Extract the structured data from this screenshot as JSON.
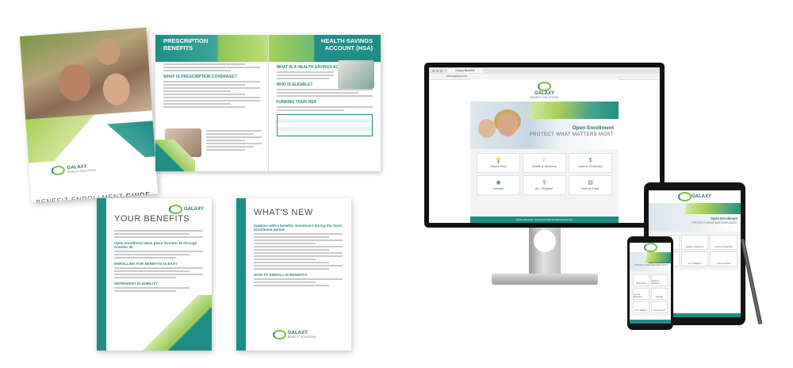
{
  "brand": {
    "name": "GALAXY",
    "tagline": "BENEFIT SOLUTIONS",
    "accent": "#1f8d86",
    "accent2": "#96c95a"
  },
  "cover": {
    "title_light": "BENEFIT ENROLLMENT",
    "title_bold": "GUIDE"
  },
  "spread": {
    "left_title": "PRESCRIPTION\nBENEFITS",
    "right_title": "HEALTH SAVINGS\nACCOUNT (HSA)",
    "left_sub": "WHAT IS PRESCRIPTION COVERAGE?",
    "right_sub": "WHAT IS A HEALTH SAVINGS ACCOUNT?",
    "right_sub2": "WHO IS ELIGIBLE?",
    "right_sub3": "FUNDING YOUR HSA"
  },
  "flyer_left": {
    "title": "YOUR BENEFITS",
    "sections": [
      "Open enrollment takes place October 16 through October 30",
      "ENROLLING FOR BENEFITS IS EASY",
      "DEPENDENT ELIGIBILITY"
    ]
  },
  "flyer_right": {
    "title": "WHAT'S NEW",
    "sections": [
      "Updates with a benefits investment during the Open Enrollment period",
      "HOW TO ENROLL IN BENEFITS"
    ]
  },
  "browser": {
    "tab_title": "Galaxy Benefits",
    "url": "www.galaxy.com"
  },
  "site": {
    "hero_title": "Open Enrollment",
    "hero_subtitle": "PROTECT WHAT MATTERS MOST",
    "tiles": [
      {
        "icon": "lightbulb-icon",
        "glyph": "💡",
        "label": "What's New"
      },
      {
        "icon": "heart-icon",
        "glyph": "♡",
        "label": "Health & Wellness"
      },
      {
        "icon": "money-icon",
        "glyph": "$",
        "label": "Income Protection"
      },
      {
        "icon": "pin-icon",
        "glyph": "◉",
        "label": "Lifestyle"
      },
      {
        "icon": "person-icon",
        "glyph": "⚲",
        "label": "Am I Eligible?"
      },
      {
        "icon": "document-icon",
        "glyph": "▤",
        "label": "How to Enroll"
      }
    ],
    "footer": "Galaxy Benefits · Copyright 2019 All Rights Reserved"
  }
}
